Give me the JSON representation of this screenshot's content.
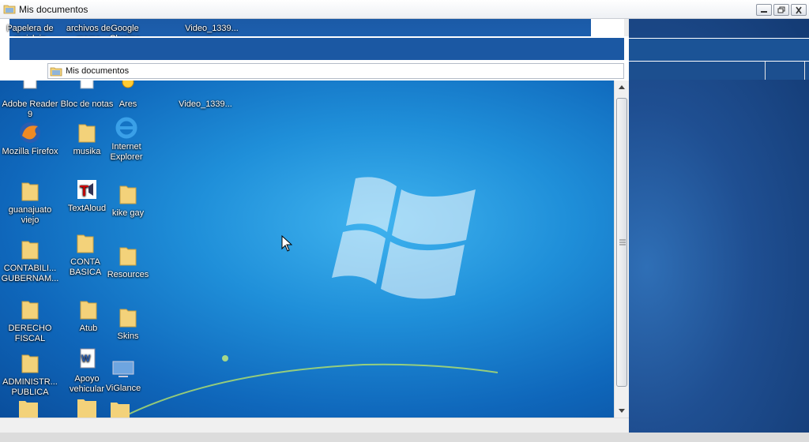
{
  "window": {
    "title": "Mis documentos"
  },
  "address": {
    "path": "Mis documentos"
  },
  "top_partial_labels": [
    "Papelera de reciclaje",
    "archivos de mama",
    "Google Chrome",
    "Video_1339..."
  ],
  "desktop_icons": [
    {
      "label": "Adobe Reader 9",
      "icon": "pdf-icon"
    },
    {
      "label": "Bloc de notas",
      "icon": "notepad-icon"
    },
    {
      "label": "Ares",
      "icon": "ares-icon"
    },
    {
      "label": "Video_1339...",
      "icon": "video-file-icon"
    },
    {
      "label": "Mozilla Firefox",
      "icon": "firefox-icon"
    },
    {
      "label": "musika",
      "icon": "folder-icon"
    },
    {
      "label": "Internet Explorer",
      "icon": "ie-icon"
    },
    {
      "label": "guanajuato viejo",
      "icon": "folder-icon"
    },
    {
      "label": "TextAloud",
      "icon": "textaloud-icon"
    },
    {
      "label": "kike gay",
      "icon": "folder-icon"
    },
    {
      "label": "CONTABILI... GUBERNAM...",
      "icon": "folder-icon"
    },
    {
      "label": "CONTA BASICA",
      "icon": "folder-icon"
    },
    {
      "label": "Resources",
      "icon": "folder-icon"
    },
    {
      "label": "DERECHO FISCAL",
      "icon": "folder-icon"
    },
    {
      "label": "Atub",
      "icon": "folder-icon"
    },
    {
      "label": "Skins",
      "icon": "folder-icon"
    },
    {
      "label": "ADMINISTR... PUBLICA",
      "icon": "folder-icon"
    },
    {
      "label": "Apoyo vehicular",
      "icon": "word-doc-icon"
    },
    {
      "label": "ViGlance",
      "icon": "monitor-icon"
    }
  ],
  "colors": {
    "desktop_center": "#3fb3ef",
    "desktop_edge": "#0a4e9c",
    "folder": "#f3d27a"
  }
}
